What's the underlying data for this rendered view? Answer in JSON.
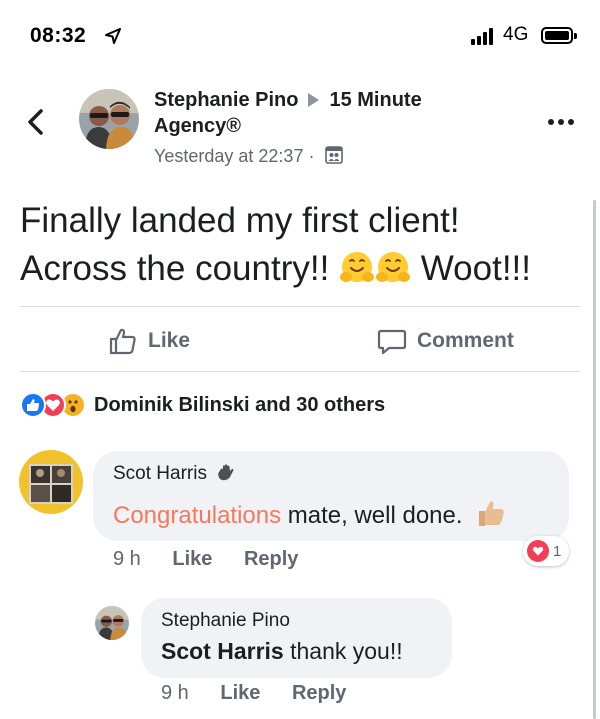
{
  "status_bar": {
    "time": "08:32",
    "network": "4G"
  },
  "post": {
    "author": "Stephanie Pino",
    "group_line1": "15 Minute",
    "group_line2": "Agency®",
    "timestamp": "Yesterday at 22:37 ·",
    "text_line1": "Finally landed my first client!",
    "text_line2": "Across the country!!",
    "text_after_emoji": "Woot!!!"
  },
  "actions": {
    "like_label": "Like",
    "comment_label": "Comment"
  },
  "reactions": {
    "summary": "Dominik Bilinski and 30 others",
    "types": [
      "like",
      "love",
      "wow"
    ]
  },
  "comments": [
    {
      "name": "Scot Harris",
      "highlight": "Congratulations",
      "text": " mate, well done.",
      "time": "9 h",
      "like_label": "Like",
      "reply_label": "Reply",
      "reaction_count": "1"
    }
  ],
  "reply": {
    "name": "Stephanie Pino",
    "mention": "Scot Harris",
    "text": " thank you!!",
    "time": "9 h",
    "like_label": "Like",
    "reply_label": "Reply"
  },
  "colors": {
    "accent_blue": "#1877f2",
    "love_red": "#f33e58",
    "wow_yellow": "#f7b125",
    "highlight_orange": "#f5785b",
    "secondary_text": "#606770"
  }
}
